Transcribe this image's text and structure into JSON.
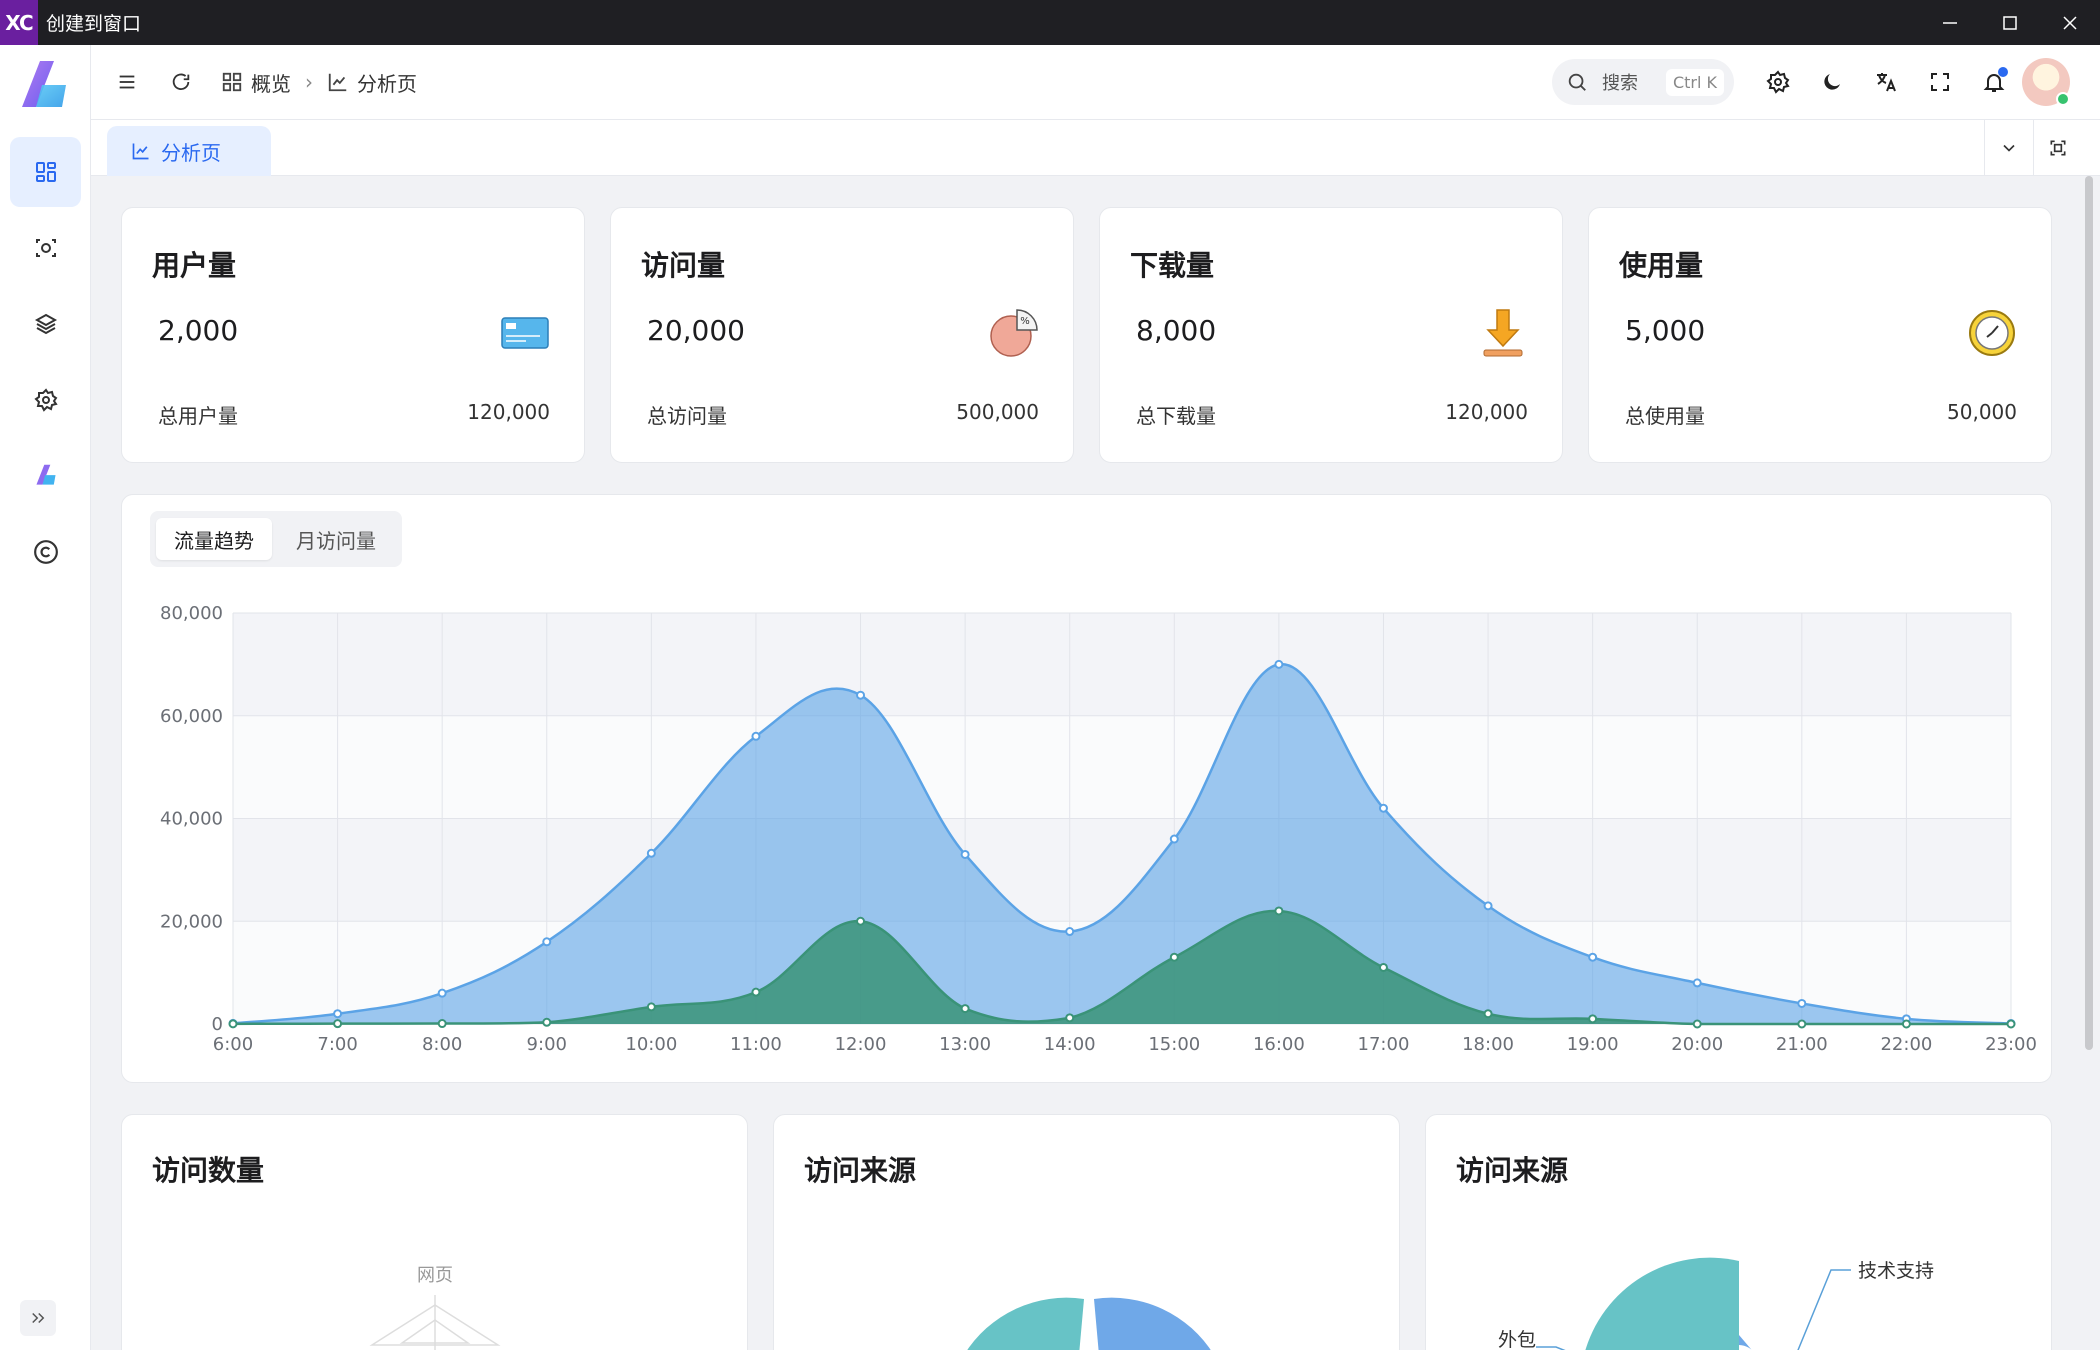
{
  "window": {
    "title": "创建到窗口",
    "logo_text": "XC"
  },
  "header": {
    "breadcrumb": [
      {
        "label": "概览",
        "icon": "dashboard-icon"
      },
      {
        "label": "分析页",
        "icon": "chart-icon"
      }
    ],
    "search": {
      "label": "搜索",
      "shortcut": "Ctrl K"
    }
  },
  "tabs": [
    {
      "label": "分析页",
      "icon": "chart-icon"
    }
  ],
  "stats": [
    {
      "title": "用户量",
      "value": "2,000",
      "sub_label": "总用户量",
      "total": "120,000",
      "icon": "card-icon"
    },
    {
      "title": "访问量",
      "value": "20,000",
      "sub_label": "总访问量",
      "total": "500,000",
      "icon": "pie-icon"
    },
    {
      "title": "下载量",
      "value": "8,000",
      "sub_label": "总下载量",
      "total": "120,000",
      "icon": "download-icon"
    },
    {
      "title": "使用量",
      "value": "5,000",
      "sub_label": "总使用量",
      "total": "50,000",
      "icon": "clock-icon"
    }
  ],
  "chart_tabs": [
    "流量趋势",
    "月访问量"
  ],
  "chart_data": {
    "type": "area",
    "x": [
      "6:00",
      "7:00",
      "8:00",
      "9:00",
      "10:00",
      "11:00",
      "12:00",
      "13:00",
      "14:00",
      "15:00",
      "16:00",
      "17:00",
      "18:00",
      "19:00",
      "20:00",
      "21:00",
      "22:00",
      "23:00"
    ],
    "ylim": [
      0,
      80000
    ],
    "yticks": [
      "0",
      "20,000",
      "40,000",
      "60,000",
      "80,000"
    ],
    "grid": true,
    "series": [
      {
        "color": "#5ba3e6",
        "values": [
          111,
          2000,
          6000,
          16000,
          33230,
          56000,
          64000,
          33000,
          18000,
          36000,
          70000,
          42000,
          23000,
          13000,
          8000,
          4000,
          1000,
          100
        ]
      },
      {
        "color": "#3a9378",
        "values": [
          33,
          66,
          88,
          333,
          3333,
          6200,
          20000,
          3000,
          1200,
          13000,
          22000,
          11000,
          2000,
          1000,
          0,
          0,
          0,
          0
        ]
      }
    ]
  },
  "bottom_cards": [
    {
      "title": "访问数量",
      "radar_label": "网页"
    },
    {
      "title": "访问来源"
    },
    {
      "title": "访问来源",
      "labels": [
        "技术支持",
        "外包"
      ]
    }
  ],
  "colors": {
    "accent": "#2a69f0",
    "area_blue": "#5ba3e6",
    "area_green": "#3a9378",
    "teal": "#67c3c6"
  }
}
